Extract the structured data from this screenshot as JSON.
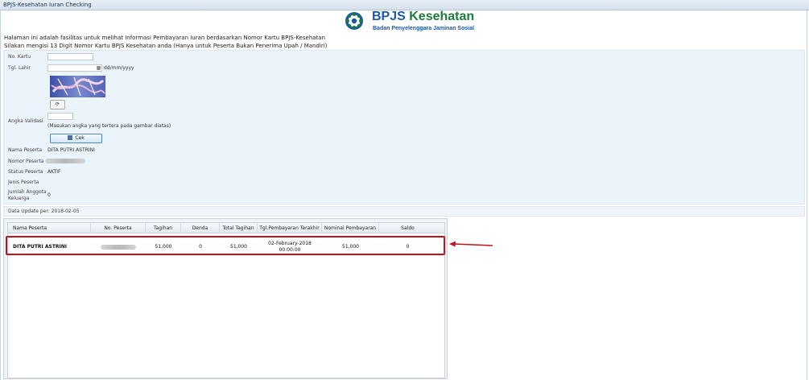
{
  "window": {
    "title": "BPJS-Kesehatan Iuran Checking"
  },
  "logo": {
    "brand_part1": "BPJS",
    "brand_part2": "Kesehatan",
    "tagline": "Badan Penyelenggara Jaminan Sosial"
  },
  "intro": {
    "line1": "Halaman ini adalah fasilitas untuk melihat Informasi Pembayaran Iuran berdasarkan Nomor Kartu BPJS-Kesehatan",
    "line2": "Silakan mengisi 13 Digit Nomor Kartu BPJS Kesehatan anda (Hanya untuk Peserta Bukan Penerima Upah / Mandiri)"
  },
  "form": {
    "no_kartu_label": "No. Kartu",
    "no_kartu_value": "",
    "tgl_lahir_label": "Tgl. Lahir",
    "tgl_lahir_value": "",
    "tgl_lahir_hint": "dd/mm/yyyy",
    "angka_validasi_label": "Angka Validasi",
    "angka_validasi_value": "",
    "validasi_hint": "(Masukan angka yang tertera pada gambar diatas)",
    "cek_label": "Cek"
  },
  "result": {
    "nama_label": "Nama Peserta",
    "nama_value": "DITA PUTRI ASTRINI",
    "nomor_label": "Nomor Peserta",
    "status_label": "Status Peserta",
    "status_value": "AKTIF",
    "jenis_label": "Jenis Peserta",
    "jumlah_label_1": "Jumlah Anggota",
    "jumlah_label_2": "Keluarga",
    "jumlah_value": "0"
  },
  "update": {
    "text": "Data Update per: 2018-02-05"
  },
  "table": {
    "headers": [
      "Nama Peserta",
      "No. Peserta",
      "Tagihan",
      "Denda",
      "Total Tagihan",
      "Tgl.Pembayaran Terakhir",
      "Nominal Pembayaran",
      "Saldo"
    ],
    "rows": [
      {
        "nama": "DITA PUTRI ASTRINI",
        "tagihan": "51,000",
        "denda": "0",
        "total": "51,000",
        "tgl_1": "02-February-2018",
        "tgl_2": "00:00:00",
        "nominal": "51,000",
        "saldo": "0"
      }
    ]
  },
  "colors": {
    "highlight": "#c0121f",
    "brand_blue": "#1c5aa6",
    "brand_green": "#1b7c3c"
  }
}
